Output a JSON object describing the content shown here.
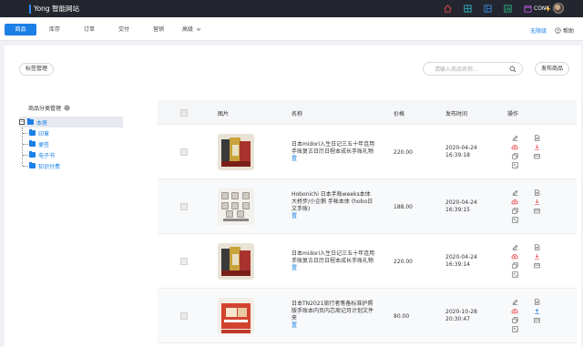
{
  "brand": {
    "name": "Yong 智能网站"
  },
  "top_icons": [
    "home-icon",
    "globe-icon",
    "layout-icon",
    "chart-icon",
    "calendar-icon",
    "flash-icon"
  ],
  "user": {
    "name": "CONY"
  },
  "nav": {
    "tabs": [
      "商品",
      "库存",
      "订单",
      "交付",
      "营销",
      "高级"
    ],
    "active": "商品",
    "permission": "无限级",
    "help": "帮助"
  },
  "toolbar": {
    "tag_manage": "标签管理",
    "search_placeholder": "请输入商品名称...",
    "publish": "发布商品"
  },
  "tree": {
    "title": "商品分类管理",
    "root": "本册",
    "children": [
      "印章",
      "便签",
      "电子书",
      "知识付费"
    ]
  },
  "table": {
    "headers": {
      "image": "图片",
      "name": "名称",
      "price": "价格",
      "time": "发布时间",
      "ops": "操作"
    },
    "rows": [
      {
        "name": "日本midori入生日记三五十年连用手账复古日历日程本成长手账礼物",
        "tag": "置",
        "price": "220.00",
        "date": "2020-04-24",
        "clock": "16:39:18",
        "thumb": "books"
      },
      {
        "name": "Hobonichi 日本手账weeks本体 大桥步/小企鹅 手帐本体 (hobo日文手账)",
        "tag": "置",
        "price": "188.00",
        "date": "2020-04-24",
        "clock": "16:39:15",
        "thumb": "stamps"
      },
      {
        "name": "日本midori入生日记三五十年连用手账复古日历日程本成长手账礼物",
        "tag": "置",
        "price": "220.00",
        "date": "2020-04-24",
        "clock": "16:39:14",
        "thumb": "books"
      },
      {
        "name": "日本TN2021旅行者笔备标准护照版手账本内页内芯周记月计划文件夹",
        "tag": "置",
        "price": "80.00",
        "date": "2020-10-28",
        "clock": "20:30:47",
        "thumb": "red"
      }
    ]
  },
  "colors": {
    "accent": "#1c80e6",
    "topbar": "#23262e",
    "danger": "#e8484b"
  }
}
